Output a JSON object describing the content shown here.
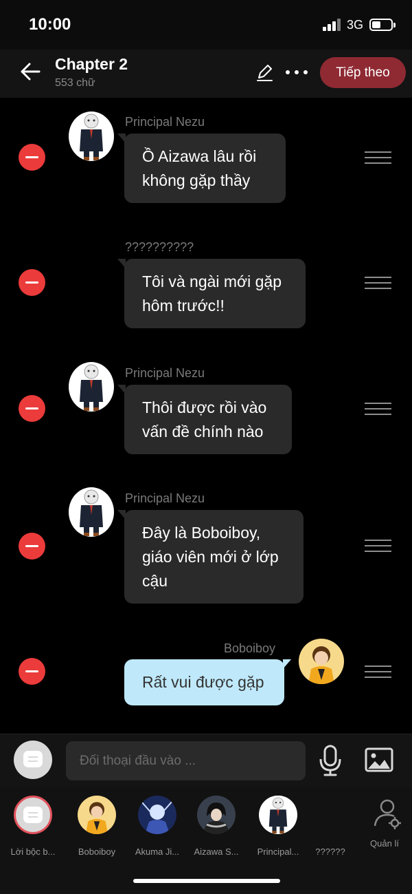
{
  "status_bar": {
    "time": "10:00",
    "network": "3G"
  },
  "header": {
    "title": "Chapter 2",
    "subtitle": "553 chữ",
    "next_button": "Tiếp theo",
    "icons": [
      "back-arrow-icon",
      "edit-pencil-icon",
      "more-dots-icon"
    ]
  },
  "messages": [
    {
      "speaker": "Principal Nezu",
      "line1": "Ồ Aizawa lâu rồi",
      "line2": "không gặp thầy",
      "line3": "",
      "side": "left",
      "avatar": "nezu"
    },
    {
      "speaker": "??????????",
      "line1": "Tôi và ngài mới gặp",
      "line2": "hôm trước!!",
      "line3": "",
      "side": "left",
      "avatar": ""
    },
    {
      "speaker": "Principal Nezu",
      "line1": "Thôi được rồi vào",
      "line2": "vấn đề chính nào",
      "line3": "",
      "side": "left",
      "avatar": "nezu"
    },
    {
      "speaker": "Principal Nezu",
      "line1": "Đây là Boboiboy,",
      "line2": "giáo viên mới ở lớp",
      "line3": "cậu",
      "side": "left",
      "avatar": "nezu"
    },
    {
      "speaker": "Boboiboy",
      "line1": "Rất vui được gặp",
      "line2": "",
      "line3": "",
      "side": "right",
      "avatar": "boboiboy"
    }
  ],
  "input": {
    "placeholder": "Đối thoại đầu vào ..."
  },
  "characters": [
    {
      "label": "Lời bộc b..."
    },
    {
      "label": "Boboiboy"
    },
    {
      "label": "Akuma Ji..."
    },
    {
      "label": "Aizawa S..."
    },
    {
      "label": "Principal..."
    },
    {
      "label": "??????"
    }
  ],
  "manage_label": "Quản lí",
  "colors": {
    "accent": "#8f2a33",
    "remove": "#ec3b3b",
    "my_bubble": "#bfe9fb",
    "bubble": "#2a2a2a"
  }
}
